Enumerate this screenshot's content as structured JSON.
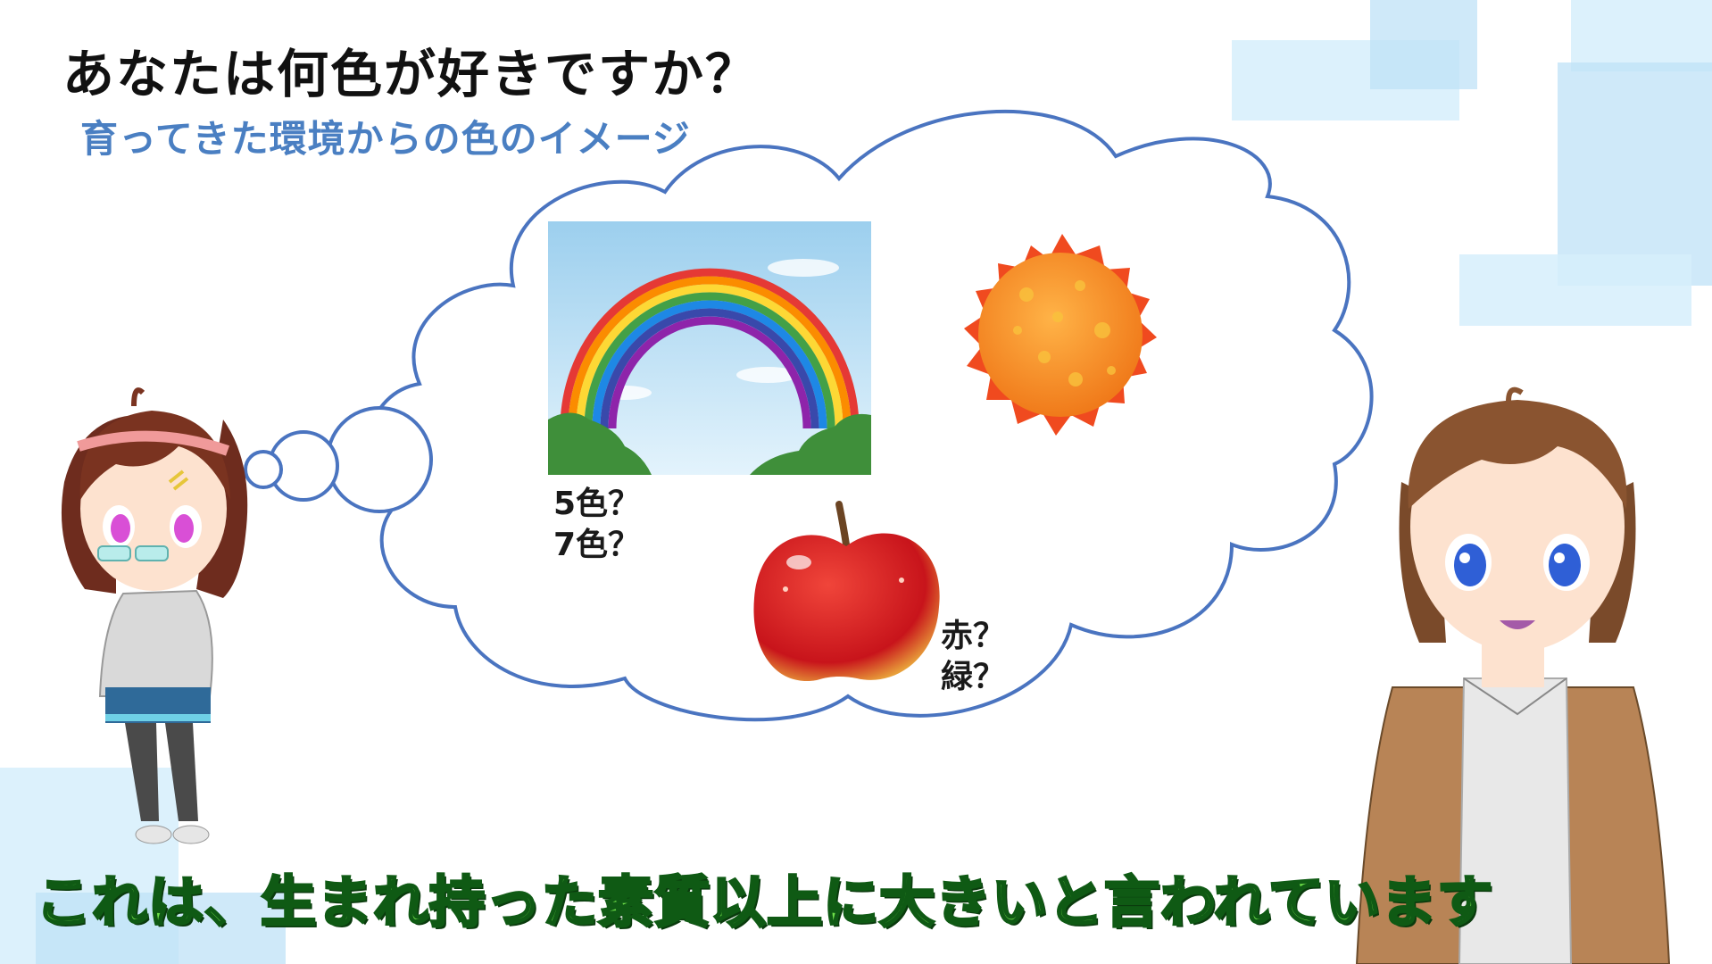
{
  "header": {
    "title": "あなたは何色が好きですか？",
    "subtitle": "育ってきた環境からの色のイメージ"
  },
  "thought_bubble": {
    "rainbow": {
      "icon": "rainbow-picture",
      "labels": [
        "5色？",
        "7色？"
      ]
    },
    "sun": {
      "icon": "sun-illustration"
    },
    "apple": {
      "icon": "red-apple-illustration",
      "labels": [
        "赤？",
        "緑？"
      ]
    }
  },
  "characters": {
    "left": {
      "icon": "thinking-girl-with-glasses"
    },
    "right": {
      "icon": "smiling-brown-hair-girl"
    }
  },
  "caption": {
    "text": "これは、生まれ持った素質以上に大きいと言われています"
  },
  "colors": {
    "bubble_outline": "#4a74c0",
    "subtitle_blue": "#4a7fc2",
    "caption_green": "#6fe04a",
    "caption_outline": "#0f5a14",
    "decor_blue": "#bfe2f7"
  }
}
